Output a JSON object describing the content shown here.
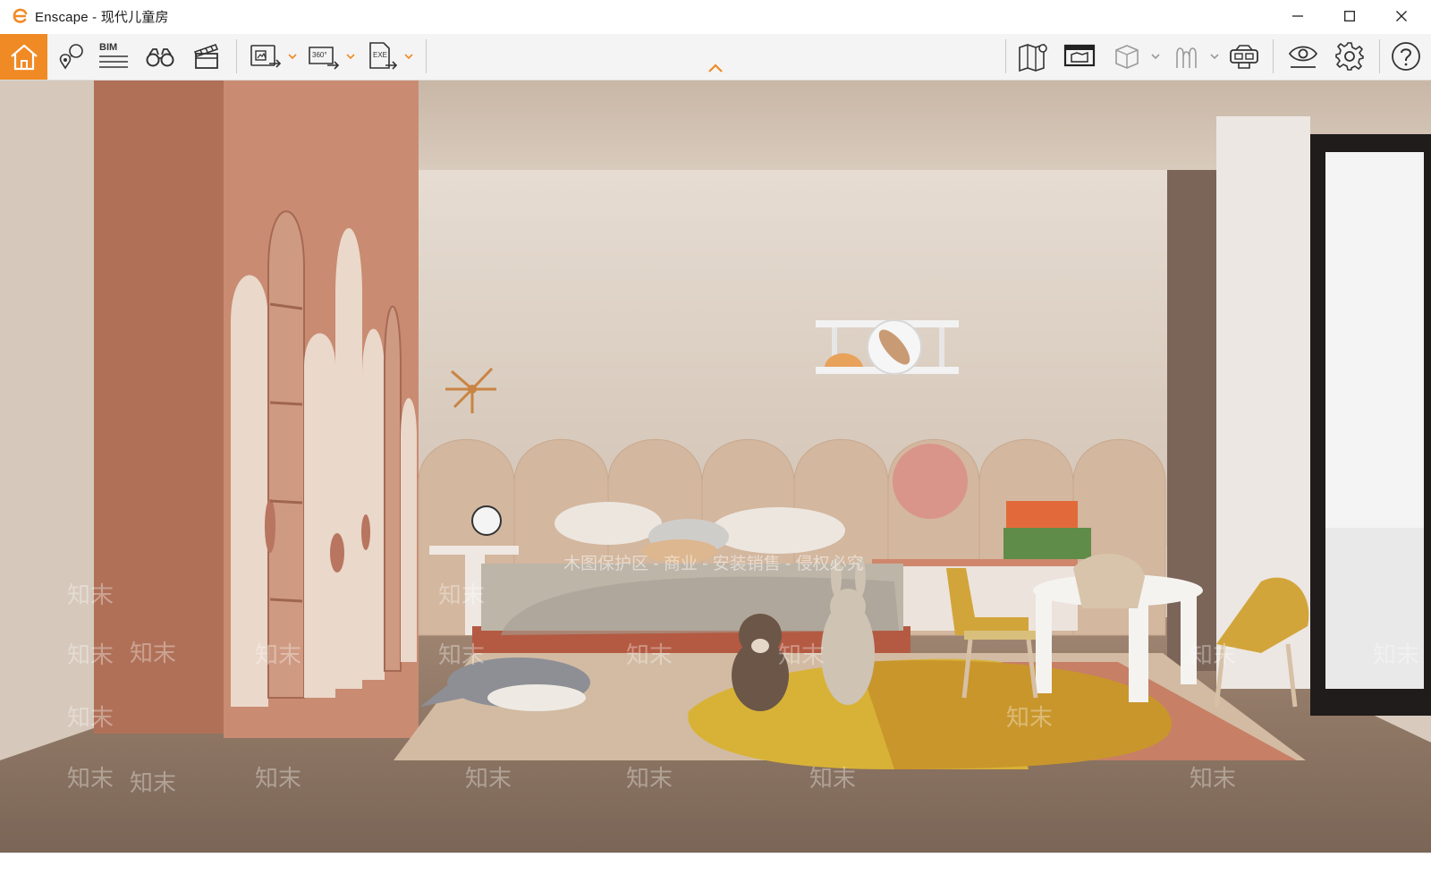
{
  "window": {
    "app_name": "Enscape",
    "separator": " - ",
    "project_name": "现代儿童房",
    "controls": {
      "minimize": "minimize-icon",
      "maximize": "maximize-icon",
      "close": "close-icon"
    }
  },
  "toolbar": {
    "accent_color": "#f08a24",
    "groups": [
      [
        "home-icon"
      ],
      [
        "location-pins-icon",
        "bim-icon",
        "binoculars-icon",
        "clapperboard-icon"
      ],
      [
        "render-image-icon",
        "panorama-360-icon",
        "export-exe-icon"
      ],
      [
        "map-icon",
        "screen-icon",
        "box-icon",
        "people-icon",
        "vr-headset-icon"
      ],
      [
        "visual-settings-icon",
        "settings-icon"
      ],
      [
        "help-icon"
      ]
    ],
    "bim_label": "BIM",
    "panorama_label": "360°",
    "exe_label": "EXE",
    "collapse": "chevron-up-icon"
  },
  "viewport": {
    "scene": "rendered-kids-bedroom",
    "watermark_text": "知末",
    "copyright_text": "木图保护区 - 商业 - 安装销售 - 侵权必究"
  }
}
